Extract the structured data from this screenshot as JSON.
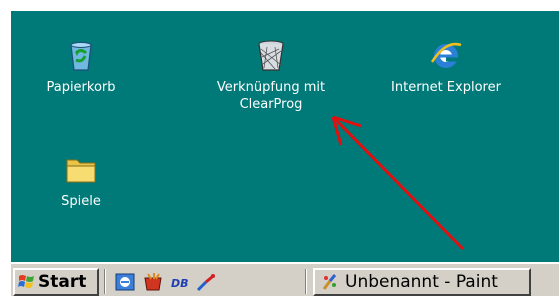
{
  "desktop": {
    "background": "#007a78",
    "icons": [
      {
        "label": "Papierkorb",
        "icon": "recycle-bin-icon"
      },
      {
        "label": "Verknüpfung mit\nClearProg",
        "icon": "wastebasket-icon"
      },
      {
        "label": "Internet Explorer",
        "icon": "internet-explorer-icon"
      },
      {
        "label": "Spiele",
        "icon": "folder-icon"
      }
    ],
    "annotation": {
      "color": "#e01010",
      "type": "arrow"
    }
  },
  "taskbar": {
    "start_label": "Start",
    "quick_launch": [
      "browser-icon",
      "game-icon",
      "database-icon",
      "tool-icon"
    ],
    "task": {
      "label": "Unbenannt - Paint",
      "icon": "paint-icon"
    }
  }
}
